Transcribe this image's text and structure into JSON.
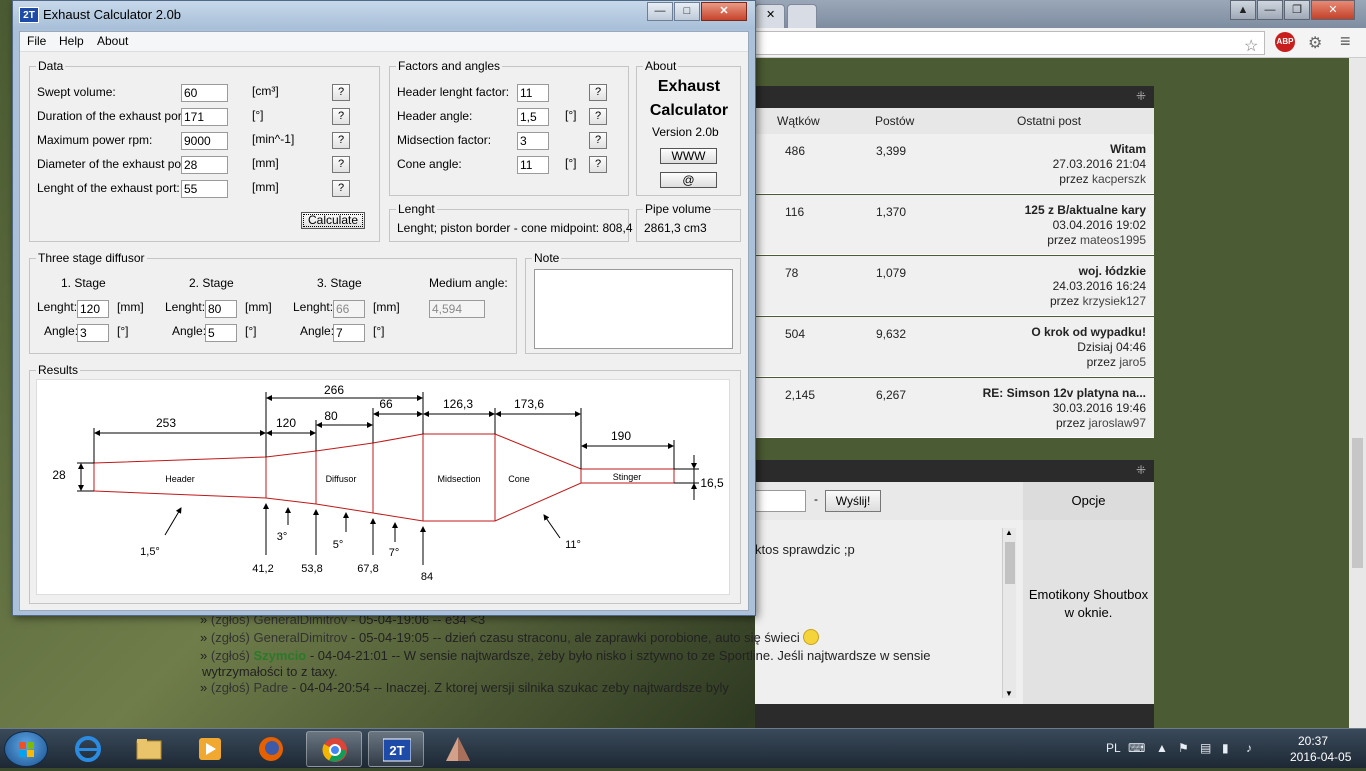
{
  "app": {
    "title": "Exhaust Calculator 2.0b",
    "logo": "2T",
    "window_buttons": {
      "minimize": "—",
      "maximize": "□",
      "close": "✕"
    },
    "menu": [
      "File",
      "Help",
      "About"
    ],
    "data_group": {
      "title": "Data",
      "rows": [
        {
          "label": "Swept volume:",
          "value": "60",
          "unit": "[cm³]",
          "help": "?"
        },
        {
          "label": "Duration of the exhaust port:",
          "value": "171",
          "unit": "[°]",
          "help": "?"
        },
        {
          "label": "Maximum power rpm:",
          "value": "9000",
          "unit": "[min^-1]",
          "help": "?"
        },
        {
          "label": "Diameter of the exhaust port:",
          "value": "28",
          "unit": "[mm]",
          "help": "?"
        },
        {
          "label": "Lenght of the exhaust port:",
          "value": "55",
          "unit": "[mm]",
          "help": "?"
        }
      ],
      "calculate_label": "Calculate"
    },
    "factors_group": {
      "title": "Factors and angles",
      "rows": [
        {
          "label": "Header lenght factor:",
          "value": "11",
          "unit": "",
          "help": "?"
        },
        {
          "label": "Header angle:",
          "value": "1,5",
          "unit": "[°]",
          "help": "?"
        },
        {
          "label": "Midsection factor:",
          "value": "3",
          "unit": "",
          "help": "?"
        },
        {
          "label": "Cone angle:",
          "value": "11",
          "unit": "[°]",
          "help": "?"
        }
      ]
    },
    "about_group": {
      "title": "About",
      "line1": "Exhaust",
      "line2": "Calculator",
      "version": "Version 2.0b",
      "www_label": "WWW",
      "email_label": "@"
    },
    "lenght_group": {
      "title": "Lenght",
      "text": "Lenght; piston border - cone midpoint:  808,4"
    },
    "pipe_volume_group": {
      "title": "Pipe volume",
      "text": "2861,3 cm3"
    },
    "diffusor_group": {
      "title": "Three stage diffusor",
      "stages": [
        {
          "header": "1. Stage",
          "lenght_label": "Lenght:",
          "lenght": "120",
          "lenght_unit": "[mm]",
          "angle_label": "Angle:",
          "angle": "3",
          "angle_unit": "[°]",
          "disabled": false
        },
        {
          "header": "2. Stage",
          "lenght_label": "Lenght:",
          "lenght": "80",
          "lenght_unit": "[mm]",
          "angle_label": "Angle:",
          "angle": "5",
          "angle_unit": "[°]",
          "disabled": false
        },
        {
          "header": "3. Stage",
          "lenght_label": "Lenght:",
          "lenght": "66",
          "lenght_unit": "[mm]",
          "angle_label": "Angle:",
          "angle": "7",
          "angle_unit": "[°]",
          "disabled": true
        }
      ],
      "medium_angle_label": "Medium angle:",
      "medium_angle": "4,594"
    },
    "note_group": {
      "title": "Note",
      "text": ""
    },
    "results_group": {
      "title": "Results",
      "dimensions": {
        "header": "253",
        "stage1": "120",
        "stage2": "80",
        "stage3": "66",
        "diffusor_total": "266",
        "midsection": "126,3",
        "cone": "173,6",
        "stinger": "190",
        "inlet_diameter": "28",
        "stinger_diameter": "16,5"
      },
      "section_labels": {
        "header": "Header",
        "diffusor": "Diffusor",
        "midsection": "Midsection",
        "cone": "Cone",
        "stinger": "Stinger"
      },
      "angles": {
        "header": "1,5°",
        "stage1": "3°",
        "stage2": "5°",
        "stage3": "7°",
        "cone": "11°"
      },
      "diameters": {
        "d1": "41,2",
        "d2": "53,8",
        "d3": "67,8",
        "d4": "84"
      }
    }
  },
  "browser": {
    "forum_columns": {
      "threads": "Wątków",
      "posts": "Postów",
      "last_post": "Ostatni post"
    },
    "forum_rows": [
      {
        "threads": "486",
        "posts": "3,399",
        "title": "Witam",
        "date": "27.03.2016 21:04",
        "by": "przez",
        "author": "kacperszk"
      },
      {
        "threads": "116",
        "posts": "1,370",
        "title": "125 z B/aktualne kary",
        "date": "03.04.2016 19:02",
        "by": "przez",
        "author": "mateos1995"
      },
      {
        "threads": "78",
        "posts": "1,079",
        "title": "woj. łódzkie",
        "date": "24.03.2016 16:24",
        "by": "przez",
        "author": "krzysiek127"
      },
      {
        "threads": "504",
        "posts": "9,632",
        "title": "O krok od wypadku!",
        "date": "Dzisiaj 04:46",
        "by": "przez",
        "author": "jaro5"
      },
      {
        "threads": "2,145",
        "posts": "6,267",
        "title": "RE: Simson 12v platyna na...",
        "date": "30.03.2016 19:46",
        "by": "przez",
        "author": "jaroslaw97"
      }
    ],
    "shout_send": "Wyślij!",
    "shout_dash": "-",
    "options": "Opcje",
    "emoticons": "Emotikony Shoutbox w oknie.",
    "shout_snippet": "ktos sprawdzic ;p",
    "shout_lines": [
      {
        "bullet": "»",
        "report": "(zgłoś)",
        "user": "GeneralDimitrov",
        "rest": " - 05-04-19:06 -- e34 <3",
        "green": false,
        "smiley": false
      },
      {
        "bullet": "»",
        "report": "(zgłoś)",
        "user": "GeneralDimitrov",
        "rest": " - 05-04-19:05 -- dzień czasu straconu, ale zaprawki porobione, auto się świeci",
        "green": false,
        "smiley": true
      },
      {
        "bullet": "»",
        "report": "(zgłoś)",
        "user": "Szymcio",
        "rest": " - 04-04-21:01 -- W sensie najtwardsze, żeby było nisko i sztywno to ze Sportline. Jeśli najtwardsze w sensie",
        "green": true,
        "smiley": false
      },
      {
        "bullet": "",
        "report": "",
        "user": "",
        "rest": "wytrzymałości to z taxy.",
        "green": false,
        "smiley": false
      },
      {
        "bullet": "»",
        "report": "(zgłoś)",
        "user": "Padre",
        "rest": " - 04-04-20:54 -- Inaczej. Z ktorej wersji silnika szukac zeby najtwardsze byly",
        "green": false,
        "smiley": false
      }
    ]
  },
  "taskbar": {
    "apps": [
      "windows-start",
      "internet-explorer",
      "file-explorer",
      "media-player",
      "firefox",
      "chrome",
      "exhaust-calculator",
      "unknown-app"
    ],
    "tray": {
      "lang": "PL",
      "time": "20:37",
      "date": "2016-04-05"
    }
  },
  "colors": {
    "pipe_outline": "#c01818",
    "dimension": "#000000",
    "link": "#444444"
  }
}
